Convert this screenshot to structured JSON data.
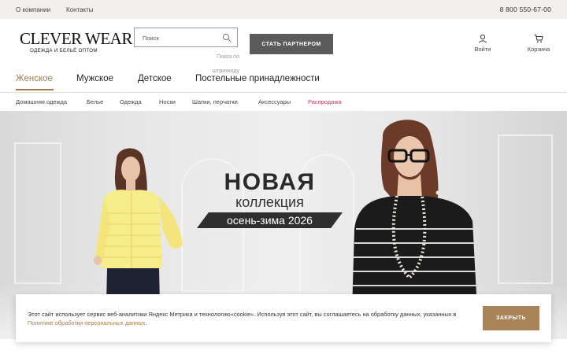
{
  "topbar": {
    "about": "О компании",
    "contacts": "Контакты",
    "phone": "8 800 550-67-00"
  },
  "logo": {
    "main": "CLEVER WEAR",
    "tagline": "ОДЕЖДА И БЕЛЬЁ ОПТОМ"
  },
  "search": {
    "placeholder": "Поиск",
    "barcode_hint": "Поиск по штрихкоду",
    "icon": "search-icon"
  },
  "partner_button": "СТАТЬ ПАРТНЕРОМ",
  "header_icons": {
    "login": {
      "label": "Войти",
      "icon": "user-icon"
    },
    "cart": {
      "label": "Корзина",
      "icon": "cart-icon"
    }
  },
  "main_nav": [
    {
      "label": "Женское",
      "active": true
    },
    {
      "label": "Мужское",
      "active": false
    },
    {
      "label": "Детское",
      "active": false
    },
    {
      "label": "Постельные принадлежности",
      "active": false
    }
  ],
  "sub_nav": [
    "Домашняя одежда",
    "Белье",
    "Одежда",
    "Носки",
    "Шапки, перчатки",
    "Аксессуары",
    "Распродажа"
  ],
  "hero": {
    "line1": "НОВАЯ",
    "line2": "коллекция",
    "line3": "осень-зима 2026",
    "prev_icon": "chevron-left-icon",
    "next_icon": "chevron-right-icon"
  },
  "cookie": {
    "text": "Этот сайт использует сервис веб-аналитики Яндекс Метрика и технологию«cookie». Используя этот сайт, вы соглашаетесь на обработку данных, указанных в",
    "link": "Политике обработки персональных данных",
    "end": ".",
    "close": "ЗАКРЫТЬ"
  },
  "colors": {
    "accent": "#a77c4a",
    "sale": "#c0395a",
    "partner_button": "#5b5b5b",
    "topbar_bg": "#f2f0ed"
  }
}
